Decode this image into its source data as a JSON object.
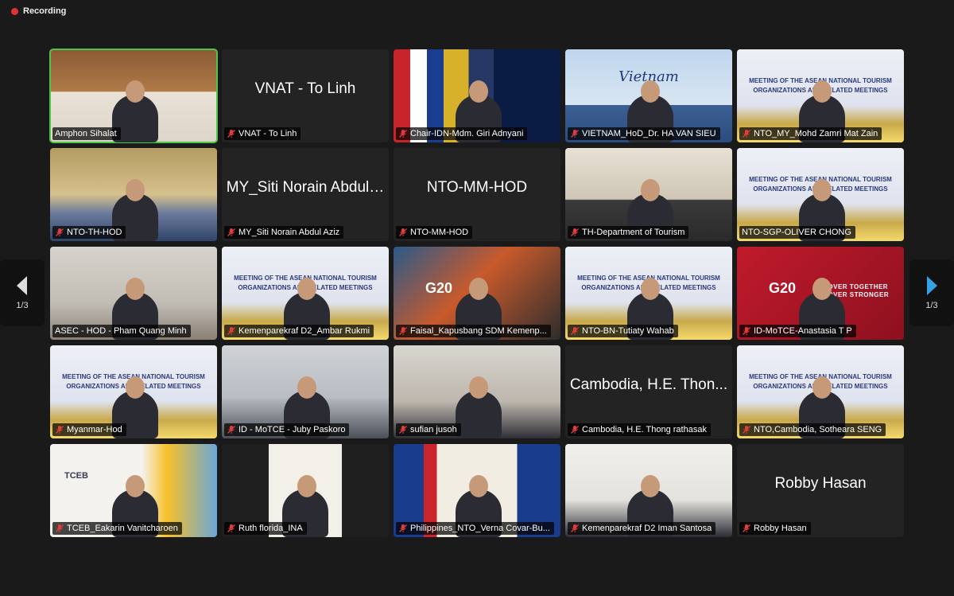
{
  "recording": {
    "label": "Recording"
  },
  "pagination": {
    "left_label": "1/3",
    "right_label": "1/3"
  },
  "participants": [
    {
      "name": "Amphon Sihalat",
      "muted": false,
      "active": true,
      "video": "v-room"
    },
    {
      "name": "VNAT - To Linh",
      "display_name": "VNAT - To Linh",
      "muted": true,
      "video": null
    },
    {
      "name": "Chair-IDN-Mdm. Giri Adnyani",
      "muted": true,
      "video": "v-flags"
    },
    {
      "name": "VIETNAM_HoD_Dr. HA VAN SIEU",
      "muted": true,
      "video": "v-vietnam",
      "banner": "Vietnam"
    },
    {
      "name": "NTO_MY_Mohd Zamri Mat Zain",
      "muted": true,
      "video": "v-laos",
      "banner": "MEETING OF THE ASEAN NATIONAL TOURISM ORGANIZATIONS AND RELATED MEETINGS"
    },
    {
      "name": "NTO-TH-HOD",
      "muted": true,
      "video": "v-th"
    },
    {
      "name": "MY_Siti Norain Abdul Aziz",
      "display_name": "MY_Siti Norain Abdul…",
      "muted": true,
      "video": null
    },
    {
      "name": "NTO-MM-HOD",
      "display_name": "NTO-MM-HOD",
      "muted": true,
      "video": null
    },
    {
      "name": "TH-Department of Tourism",
      "muted": true,
      "video": "v-office"
    },
    {
      "name": "NTO-SGP-OLIVER CHONG",
      "muted": false,
      "video": "v-laos",
      "banner": "MEETING OF THE ASEAN NATIONAL TOURISM ORGANIZATIONS AND RELATED MEETINGS"
    },
    {
      "name": "ASEC - HOD - Pham Quang Minh",
      "muted": false,
      "video": "v-asec"
    },
    {
      "name": "Kemenparekraf D2_Ambar Rukmi",
      "muted": true,
      "video": "v-laos",
      "banner": "MEETING OF THE ASEAN NATIONAL TOURISM ORGANIZATIONS AND RELATED MEETINGS"
    },
    {
      "name": "Faisal_Kapusbang SDM Kemenp...",
      "muted": true,
      "video": "v-g20",
      "banner": "G20"
    },
    {
      "name": "NTO-BN-Tutiaty Wahab",
      "muted": true,
      "video": "v-laos",
      "banner": "MEETING OF THE ASEAN NATIONAL TOURISM ORGANIZATIONS AND RELATED MEETINGS"
    },
    {
      "name": "ID-MoTCE-Anastasia T P",
      "muted": true,
      "video": "v-g20red",
      "banner": "G20",
      "banner2": "RECOVER TOGETHER RECOVER STRONGER"
    },
    {
      "name": "Myanmar-Hod",
      "muted": true,
      "video": "v-laos",
      "banner": "MEETING OF THE ASEAN NATIONAL TOURISM ORGANIZATIONS AND RELATED MEETINGS"
    },
    {
      "name": "ID - MoTCE - Juby Paskoro",
      "muted": true,
      "video": "v-gray"
    },
    {
      "name": "sufian jusoh",
      "muted": true,
      "video": "v-desk"
    },
    {
      "name": "Cambodia, H.E. Thong rathasak",
      "display_name": "Cambodia, H.E. Thon...",
      "muted": true,
      "video": null
    },
    {
      "name": "NTO,Cambodia, Sotheara SENG",
      "muted": true,
      "video": "v-laos",
      "banner": "MEETING OF THE ASEAN NATIONAL TOURISM ORGANIZATIONS AND RELATED MEETINGS"
    },
    {
      "name": "TCEB_Eakarin Vanitcharoen",
      "muted": true,
      "video": "v-tceb",
      "banner": "TCEB"
    },
    {
      "name": "Ruth florida_INA",
      "muted": true,
      "video": "v-wall"
    },
    {
      "name": "Philippines_NTO_Verna Covar-Bu...",
      "muted": true,
      "video": "v-ph"
    },
    {
      "name": "Kemenparekraf D2 Iman Santosa",
      "muted": true,
      "video": "v-bright"
    },
    {
      "name": "Robby Hasan",
      "display_name": "Robby Hasan",
      "muted": true,
      "video": null
    }
  ]
}
